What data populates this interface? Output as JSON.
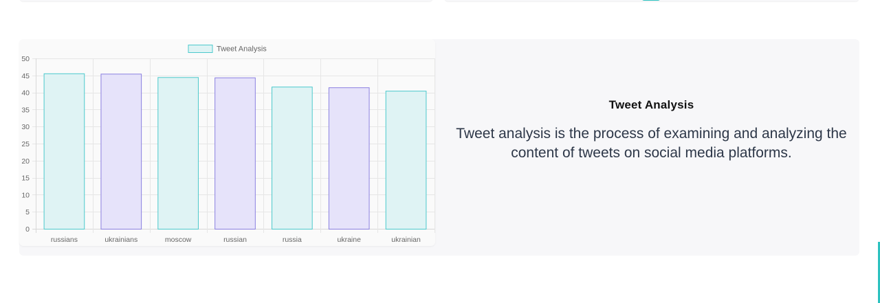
{
  "chart_data": {
    "type": "bar",
    "title": "",
    "xlabel": "",
    "ylabel": "",
    "categories": [
      "russians",
      "ukrainians",
      "moscow",
      "russian",
      "russia",
      "ukraine",
      "ukrainian"
    ],
    "series": [
      {
        "name": "Tweet Analysis",
        "values": [
          45.6,
          45.5,
          44.5,
          44.4,
          41.7,
          41.5,
          40.5
        ]
      }
    ],
    "ylim": [
      0,
      50
    ],
    "yticks": [
      0,
      5,
      10,
      15,
      20,
      25,
      30,
      35,
      40,
      45,
      50
    ],
    "grid": true,
    "legend": "top-center",
    "colors": {
      "teal_fill": "#dff3f4",
      "teal_border": "#4bc9cc",
      "purple_fill": "#e6e3fa",
      "purple_border": "#8a7fe0"
    }
  },
  "info": {
    "title": "Tweet Analysis",
    "body": "Tweet analysis is the process of examining and analyzing the content of tweets on social media platforms."
  }
}
